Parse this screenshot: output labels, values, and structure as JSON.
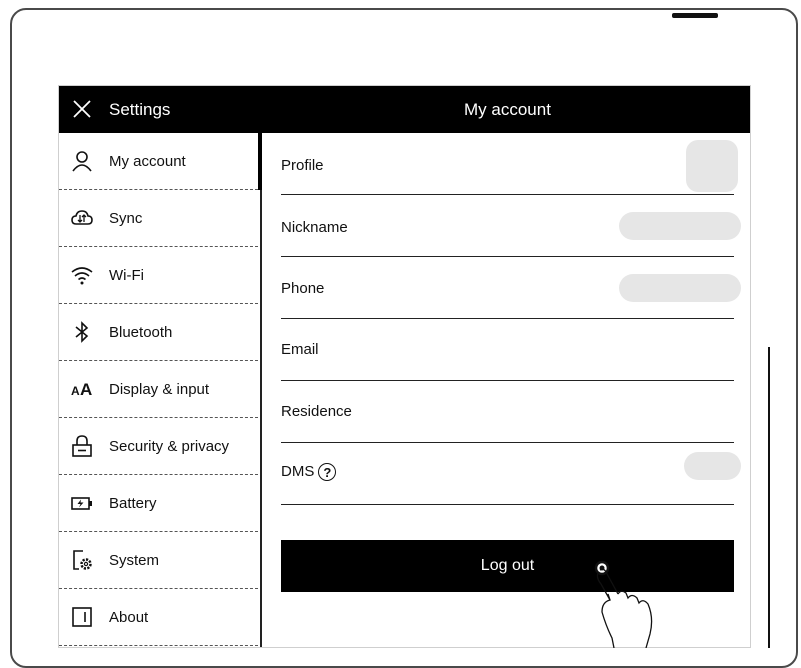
{
  "header": {
    "close_icon": "close-icon",
    "settings_label": "Settings",
    "page_title": "My account"
  },
  "sidebar": {
    "items": [
      {
        "label": "My account",
        "icon": "person-icon",
        "active": true
      },
      {
        "label": "Sync",
        "icon": "cloud-sync-icon"
      },
      {
        "label": "Wi-Fi",
        "icon": "wifi-icon"
      },
      {
        "label": "Bluetooth",
        "icon": "bluetooth-icon"
      },
      {
        "label": "Display & input",
        "icon": "text-size-icon"
      },
      {
        "label": "Security & privacy",
        "icon": "lock-icon"
      },
      {
        "label": "Battery",
        "icon": "battery-icon"
      },
      {
        "label": "System",
        "icon": "system-gear-icon"
      },
      {
        "label": "About",
        "icon": "about-icon"
      }
    ]
  },
  "account": {
    "rows": [
      {
        "label": "Profile"
      },
      {
        "label": "Nickname"
      },
      {
        "label": "Phone"
      },
      {
        "label": "Email"
      },
      {
        "label": "Residence"
      },
      {
        "label": "DMS"
      }
    ],
    "logout_label": "Log out"
  },
  "colors": {
    "topbar": "#000000",
    "button": "#000000",
    "placeholder": "#e6e6e6"
  }
}
